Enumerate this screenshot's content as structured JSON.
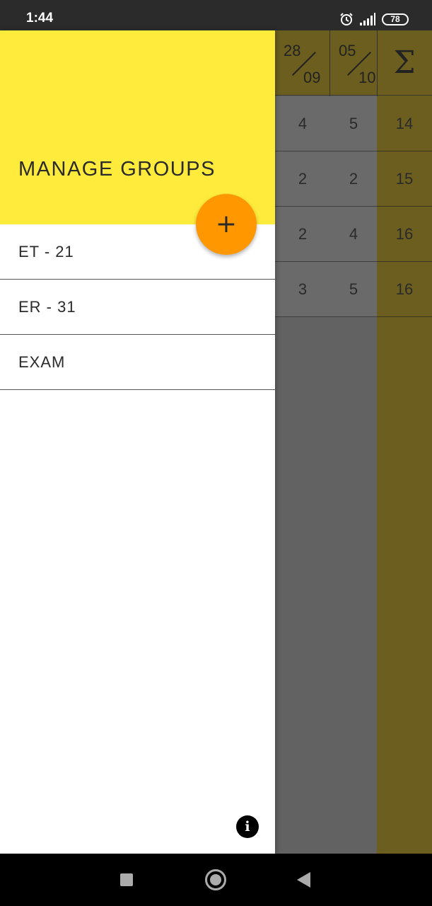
{
  "status_bar": {
    "time": "1:44",
    "battery": "78",
    "icons": [
      "alarm-icon",
      "signal-icon",
      "battery-icon"
    ]
  },
  "table": {
    "headers": {
      "col1": {
        "day": "28",
        "month": "09"
      },
      "col2": {
        "day": "05",
        "month": "10"
      },
      "sum_symbol": "Σ"
    },
    "rows": [
      {
        "c1": "4",
        "c2": "5",
        "sum": "14"
      },
      {
        "c1": "2",
        "c2": "2",
        "sum": "15"
      },
      {
        "c1": "2",
        "c2": "4",
        "sum": "16"
      },
      {
        "c1": "3",
        "c2": "5",
        "sum": "16"
      }
    ]
  },
  "drawer": {
    "title": "MANAGE GROUPS",
    "fab_icon": "plus-icon",
    "fab_symbol": "+",
    "groups": [
      {
        "label": "ET - 21"
      },
      {
        "label": "ER - 31"
      },
      {
        "label": "EXAM"
      }
    ],
    "info_symbol": "i"
  },
  "nav": {
    "icons": [
      "recents-icon",
      "home-icon",
      "back-icon"
    ]
  },
  "colors": {
    "drawer_header": "#ffeb3b",
    "fab": "#ff9800",
    "sum_column": "#6b5e1f"
  }
}
